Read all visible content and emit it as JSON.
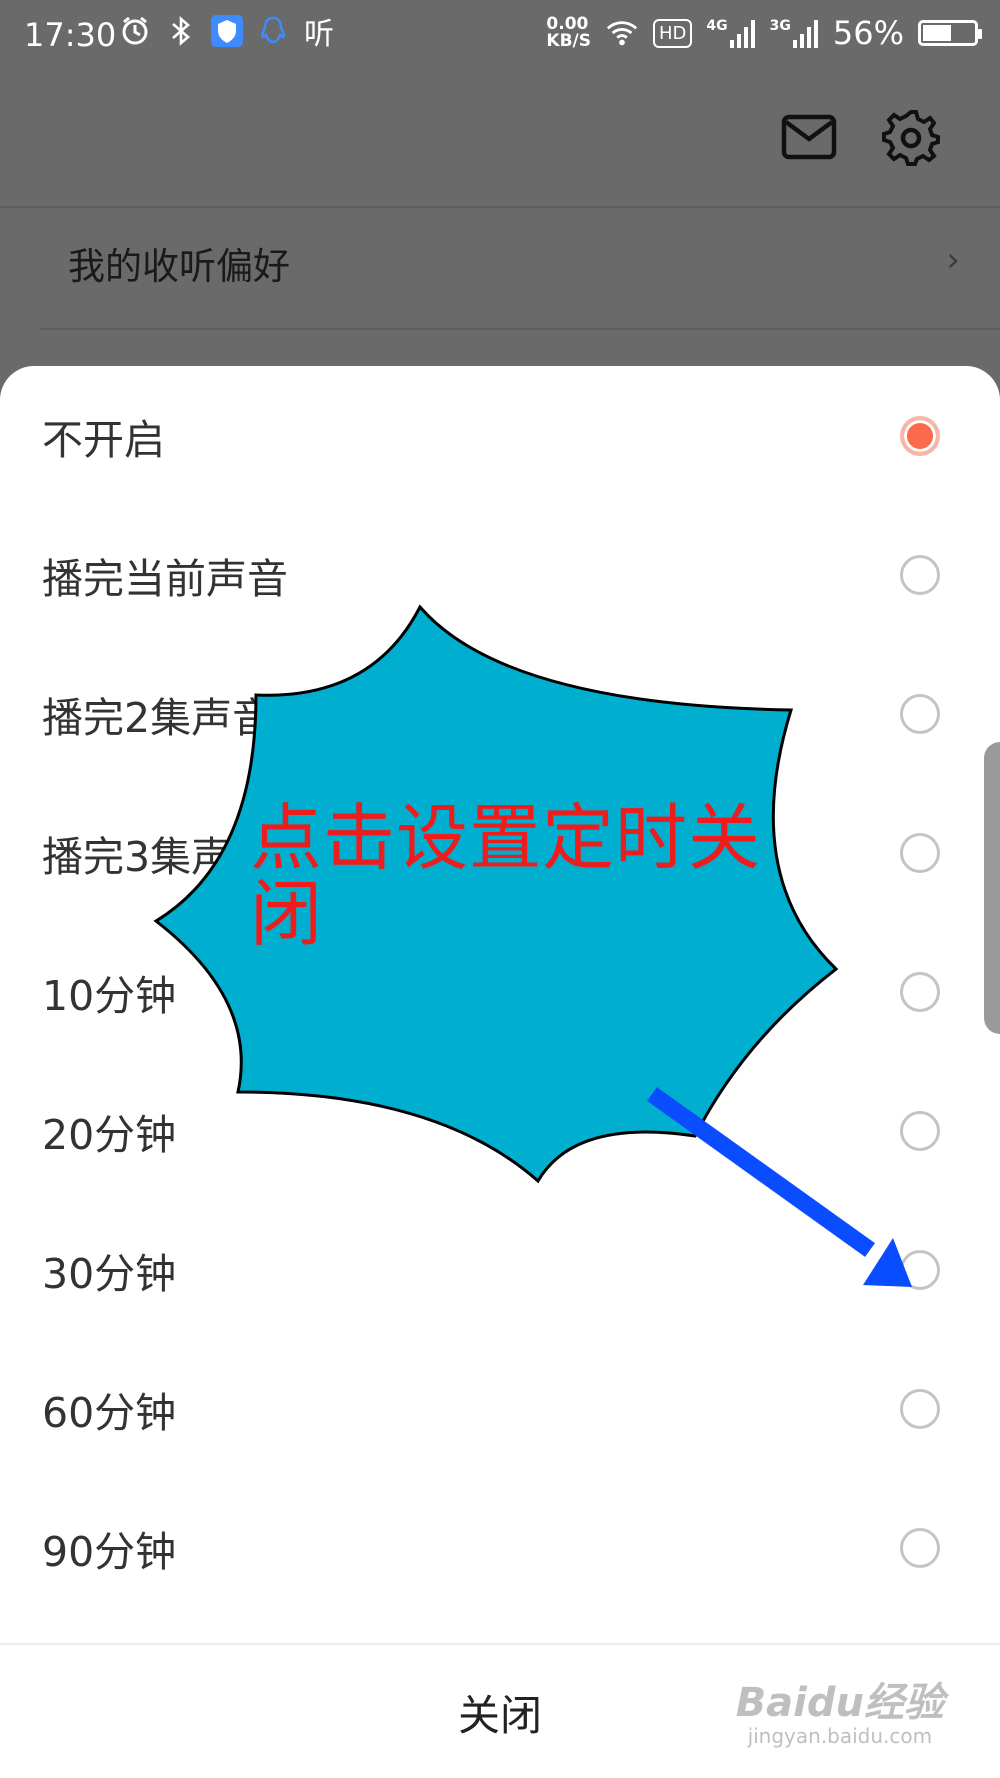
{
  "status_bar": {
    "time": "17:30",
    "net_speed_value": "0.00",
    "net_speed_unit": "KB/S",
    "hd_label": "HD",
    "signal_4g": "4G",
    "signal_3g": "3G",
    "battery_text": "56%",
    "battery_level_percent": 56
  },
  "header": {
    "preference_label": "我的收听偏好",
    "preference_chevron": "›"
  },
  "sheet": {
    "options": [
      {
        "label": "不开启",
        "selected": true
      },
      {
        "label": "播完当前声音",
        "selected": false
      },
      {
        "label": "播完2集声音",
        "selected": false
      },
      {
        "label": "播完3集声音",
        "selected": false
      },
      {
        "label": "10分钟",
        "selected": false
      },
      {
        "label": "20分钟",
        "selected": false
      },
      {
        "label": "30分钟",
        "selected": false
      },
      {
        "label": "60分钟",
        "selected": false
      },
      {
        "label": "90分钟",
        "selected": false
      }
    ],
    "close_label": "关闭"
  },
  "annotation": {
    "text": "点击设置定时关闭",
    "fill_color": "#00aed0",
    "text_color": "#ee1c1c",
    "arrow_color": "#0a4cff"
  },
  "watermark": {
    "logo": "Baidu经验",
    "url": "jingyan.baidu.com"
  },
  "icons": {
    "mail": "mail-icon",
    "settings": "gear-icon",
    "alarm": "alarm-icon",
    "bluetooth": "bluetooth-icon",
    "shield": "shield-icon",
    "qq": "qq-icon",
    "ting_app": "听",
    "wifi": "wifi-icon"
  },
  "colors": {
    "accent_radio": "#fb6a4b",
    "overlay_dim": "#6a6a6a"
  }
}
